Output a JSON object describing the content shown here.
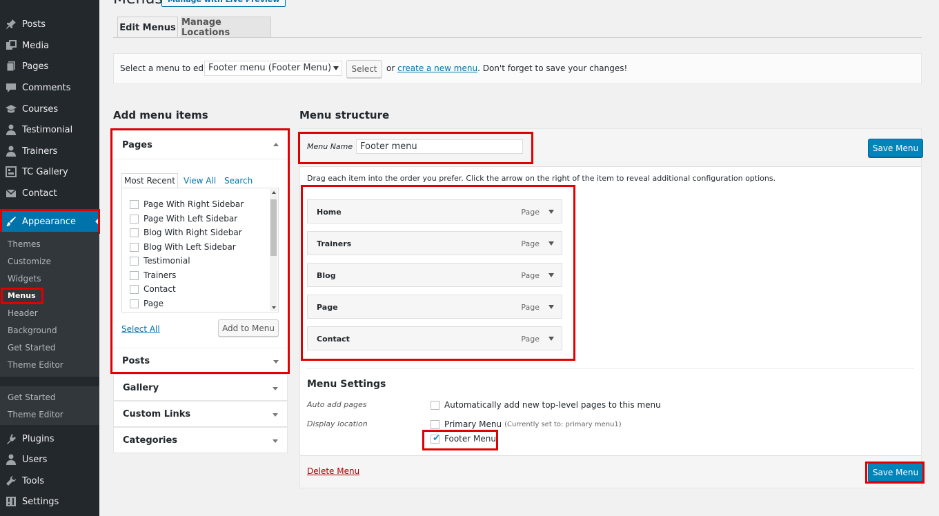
{
  "sidebar": {
    "items_top": [
      {
        "label": "Posts",
        "icon": "pin-icon",
        "key": "posts"
      },
      {
        "label": "Media",
        "icon": "media-icon",
        "key": "media"
      },
      {
        "label": "Pages",
        "icon": "pages-icon",
        "key": "pages"
      },
      {
        "label": "Comments",
        "icon": "comments-icon",
        "key": "comments"
      },
      {
        "label": "Courses",
        "icon": "courses-icon",
        "key": "courses"
      },
      {
        "label": "Testimonial",
        "icon": "user-icon",
        "key": "testimonial"
      },
      {
        "label": "Trainers",
        "icon": "user-icon",
        "key": "trainers"
      },
      {
        "label": "TC Gallery",
        "icon": "gallery-icon",
        "key": "tc-gallery"
      },
      {
        "label": "Contact",
        "icon": "mail-icon",
        "key": "contact"
      }
    ],
    "active": {
      "label": "Appearance",
      "icon": "brush-icon"
    },
    "appearance_sub": [
      "Themes",
      "Customize",
      "Widgets",
      "Menus",
      "Header",
      "Background",
      "Get Started",
      "Theme Editor"
    ],
    "extra_sub": [
      "Get Started",
      "Theme Editor"
    ],
    "items_bottom": [
      {
        "label": "Plugins",
        "icon": "plugin-icon",
        "key": "plugins"
      },
      {
        "label": "Users",
        "icon": "user-icon",
        "key": "users"
      },
      {
        "label": "Tools",
        "icon": "wrench-icon",
        "key": "tools"
      },
      {
        "label": "Settings",
        "icon": "settings-icon",
        "key": "settings"
      }
    ]
  },
  "header": {
    "title": "Menus",
    "live_preview": "Manage with Live Preview"
  },
  "tabs": [
    "Edit Menus",
    "Manage Locations"
  ],
  "select_bar": {
    "label": "Select a menu to edit:",
    "selected": "Footer menu (Footer Menu)",
    "button": "Select",
    "or": "or",
    "create_link": "create a new menu",
    "suffix": ". Don't forget to save your changes!"
  },
  "add_items": {
    "title": "Add menu items",
    "pages": {
      "title": "Pages",
      "tabs": [
        "Most Recent",
        "View All",
        "Search"
      ],
      "list": [
        "Page With Right Sidebar",
        "Page With Left Sidebar",
        "Blog With Right Sidebar",
        "Blog With Left Sidebar",
        "Testimonial",
        "Trainers",
        "Contact",
        "Page"
      ],
      "select_all": "Select All",
      "add_button": "Add to Menu"
    },
    "sections": [
      "Posts",
      "Gallery",
      "Custom Links",
      "Categories"
    ]
  },
  "structure": {
    "title": "Menu structure",
    "menu_name_label": "Menu Name",
    "menu_name_value": "Footer menu",
    "save_label": "Save Menu",
    "drag_text": "Drag each item into the order you prefer. Click the arrow on the right of the item to reveal additional configuration options.",
    "items": [
      {
        "title": "Home",
        "type": "Page"
      },
      {
        "title": "Trainers",
        "type": "Page"
      },
      {
        "title": "Blog",
        "type": "Page"
      },
      {
        "title": "Page",
        "type": "Page"
      },
      {
        "title": "Contact",
        "type": "Page"
      }
    ],
    "settings": {
      "title": "Menu Settings",
      "auto_add_label": "Auto add pages",
      "auto_add_text": "Automatically add new top-level pages to this menu",
      "display_label": "Display location",
      "primary_text": "Primary Menu",
      "primary_note": "(Currently set to: primary menu1)",
      "footer_text": "Footer Menu"
    },
    "delete_label": "Delete Menu"
  },
  "colors": {
    "accent": "#0073aa",
    "sidebar": "#23282d",
    "highlight": "#e00000",
    "primary_button": "#0085ba"
  }
}
